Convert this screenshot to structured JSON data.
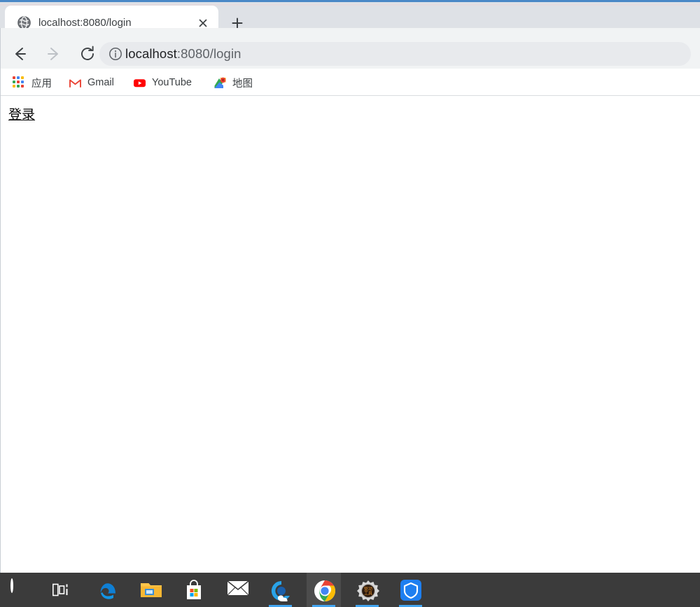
{
  "window": {
    "accent_color": "#4a88c7",
    "tabstrip_bg": "#dee1e6",
    "toolbar_bg": "#f1f3f4"
  },
  "tabstrip": {
    "active_tab": {
      "title": "localhost:8080/login",
      "favicon": "globe-icon"
    },
    "close_label": "×",
    "new_tab_label": "+"
  },
  "toolbar": {
    "back_label": "back-arrow-icon",
    "forward_label": "forward-arrow-icon",
    "reload_label": "reload-icon",
    "omnibox": {
      "site_info_icon": "info-circle-icon",
      "url_host": "localhost",
      "url_rest": ":8080/login",
      "full_url": "localhost:8080/login"
    }
  },
  "bookmarks": [
    {
      "label": "应用",
      "icon": "google-apps-grid-icon"
    },
    {
      "label": "Gmail",
      "icon": "gmail-m-icon"
    },
    {
      "label": "YouTube",
      "icon": "youtube-play-icon"
    },
    {
      "label": "地图",
      "icon": "google-maps-pin-icon"
    }
  ],
  "page": {
    "link_text": "登录"
  },
  "taskbar": {
    "bg_color": "#3b3b3b",
    "active_highlight": "#4c4c4c",
    "running_indicator_color": "#43a5f0",
    "items": [
      {
        "name": "cortana",
        "label": "Cortana",
        "running": false
      },
      {
        "name": "task-view",
        "label": "Task View",
        "running": false
      },
      {
        "name": "microsoft-edge",
        "label": "Microsoft Edge",
        "running": false
      },
      {
        "name": "file-explorer",
        "label": "File Explorer",
        "running": false
      },
      {
        "name": "microsoft-store",
        "label": "Microsoft Store",
        "running": false
      },
      {
        "name": "mail",
        "label": "Mail",
        "running": false
      },
      {
        "name": "qq-browser",
        "label": "QQ Browser",
        "running": true
      },
      {
        "name": "google-chrome",
        "label": "Google Chrome",
        "running": true
      },
      {
        "name": "driver-tool",
        "label": "驱动工具",
        "running": true
      },
      {
        "name": "tencent-pc-manager",
        "label": "Tencent PC Manager",
        "running": true
      }
    ]
  }
}
